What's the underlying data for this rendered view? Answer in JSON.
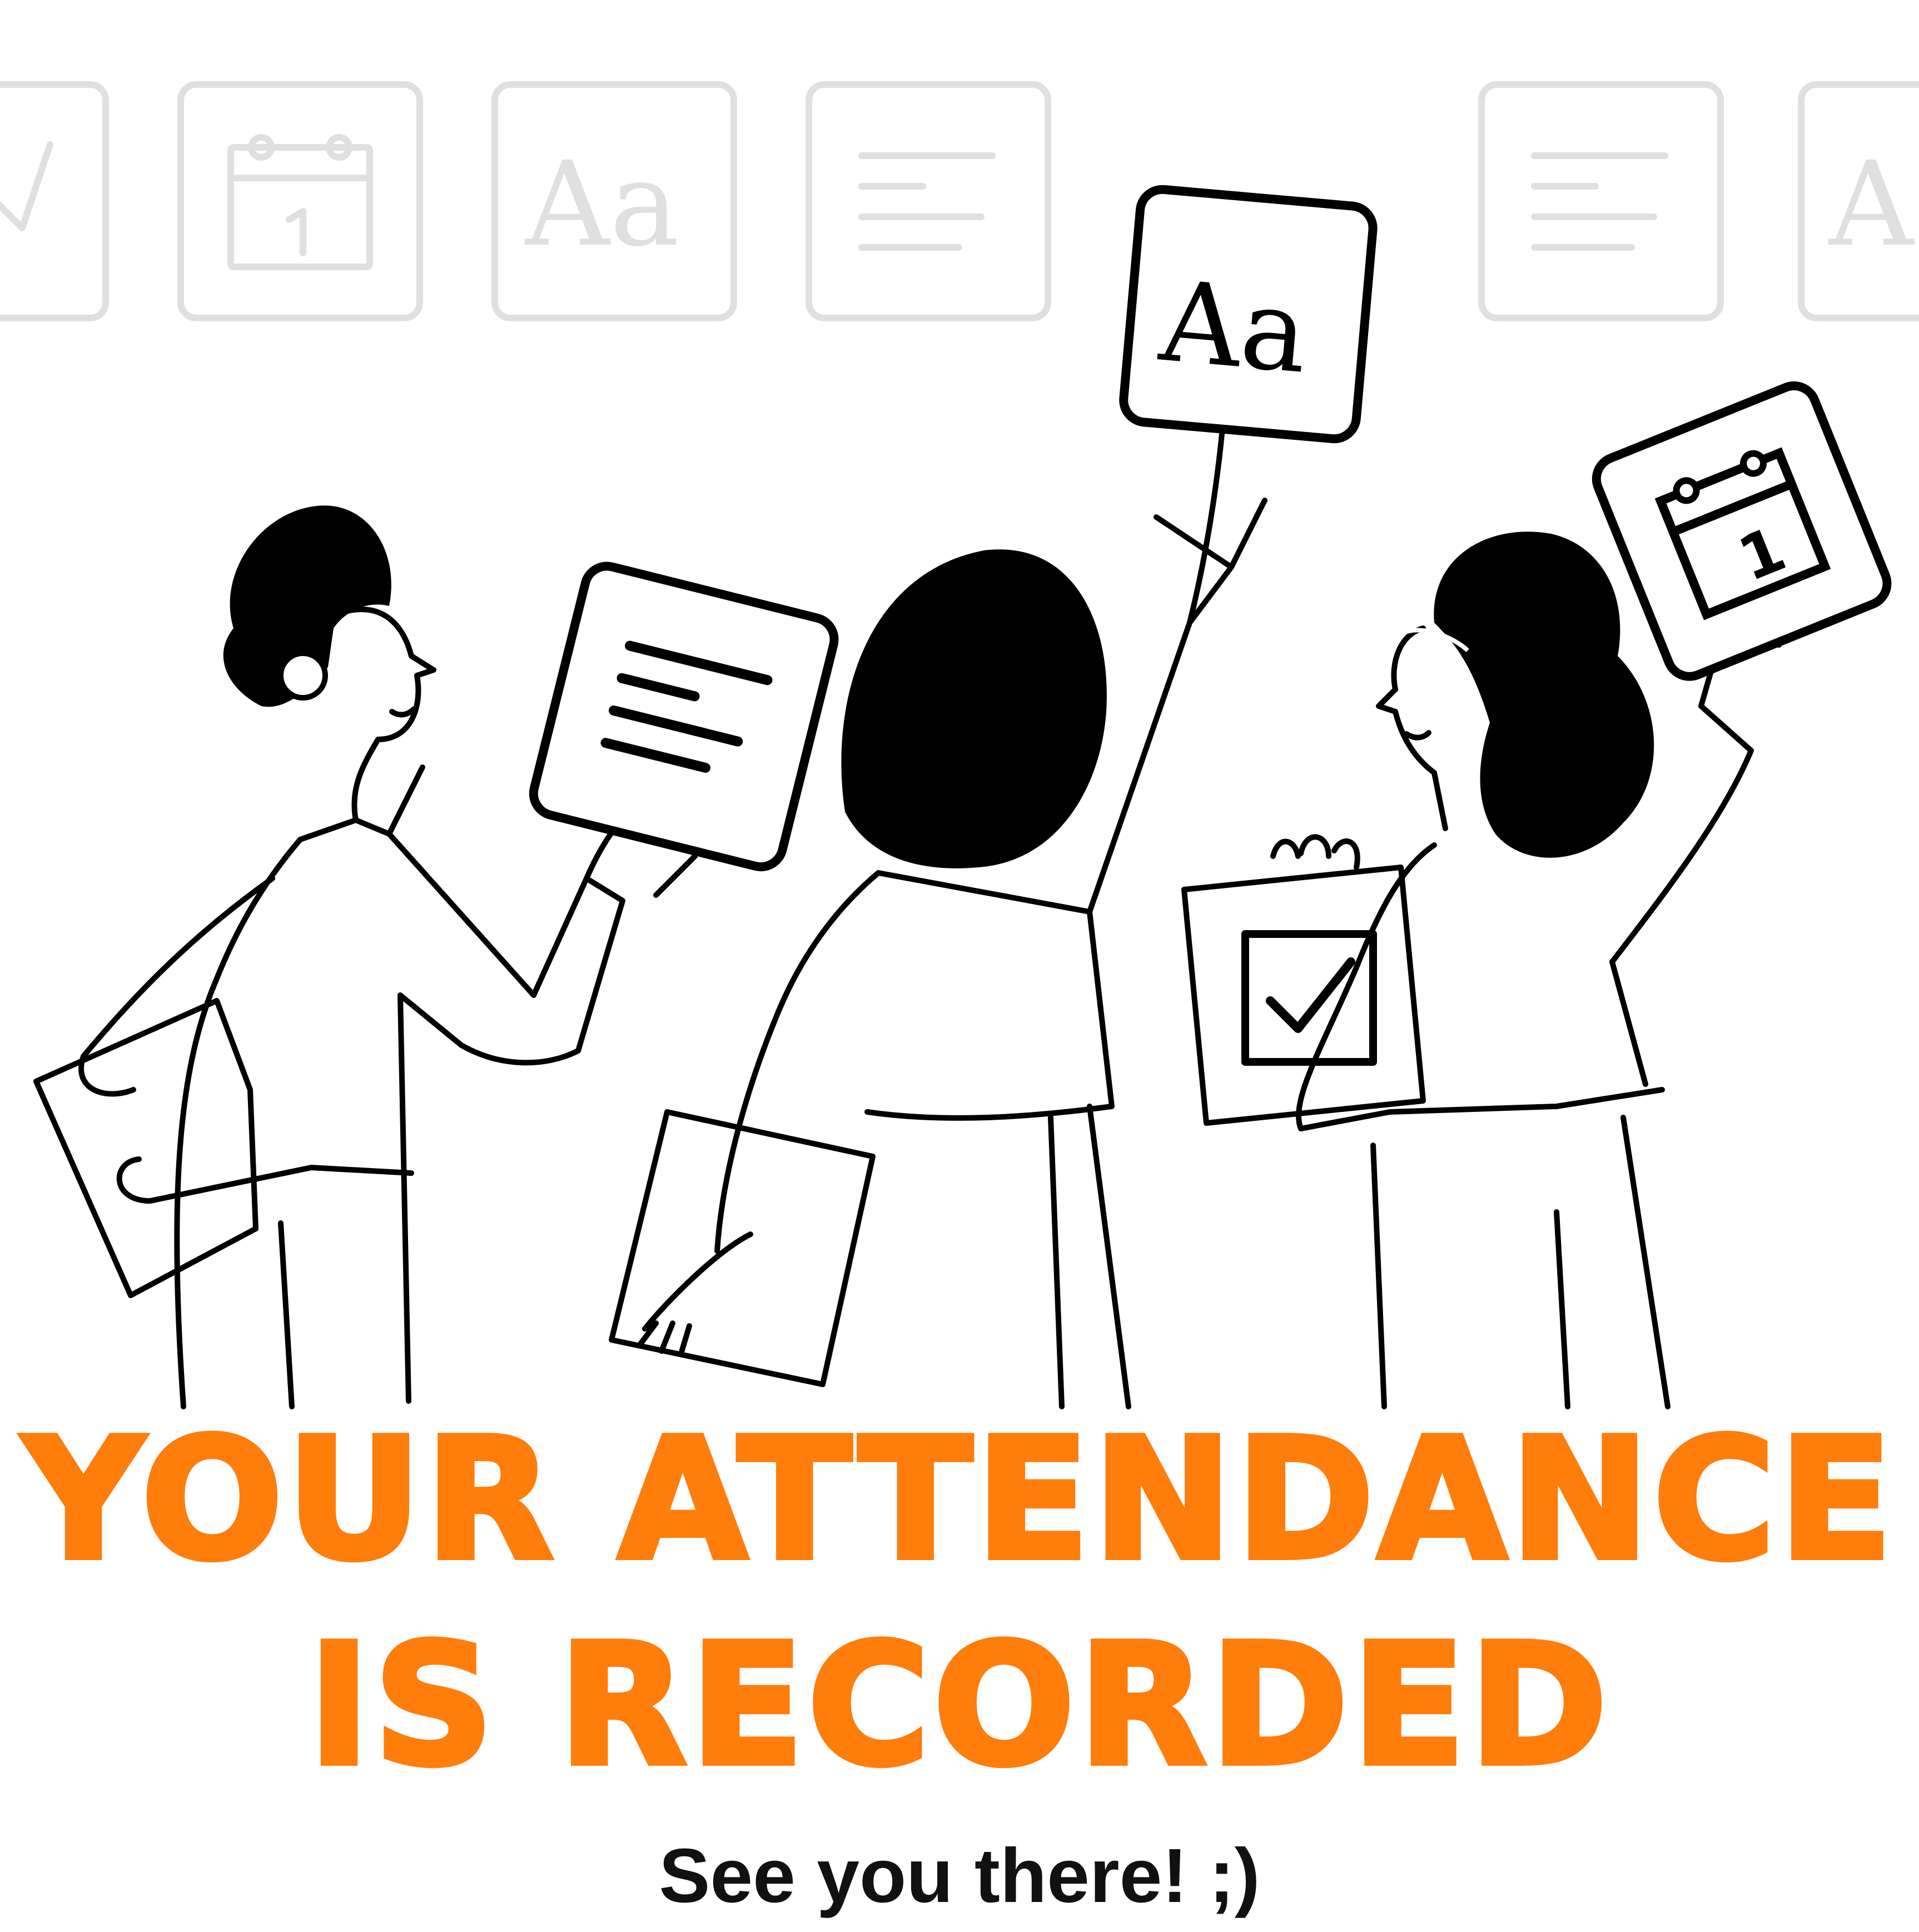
{
  "headline": {
    "line1": "YOUR ATTENDANCE",
    "line2": "IS RECORDED",
    "color": "#ff7d0a"
  },
  "subtext": "See you there! ;)",
  "illustration": {
    "card_glyph_text": "Aa",
    "calendar_day": "1",
    "background_tiles": [
      "checkbox-icon",
      "calendar-icon",
      "text-style-icon",
      "paragraph-icon",
      "paragraph-icon",
      "text-style-icon"
    ],
    "held_cards": [
      "paragraph-icon",
      "text-style-icon",
      "calendar-icon",
      "checkbox-icon"
    ],
    "tile_color": "#e0e0e0",
    "line_color": "#000000"
  }
}
